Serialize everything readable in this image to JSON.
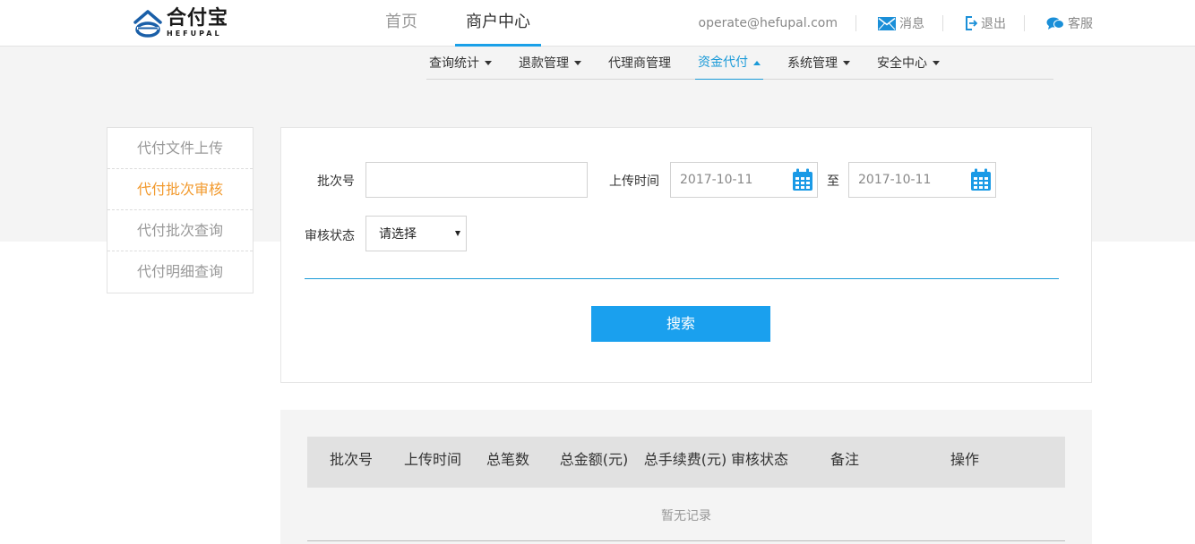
{
  "brand": {
    "name_cn": "合付宝",
    "name_en": "HEFUPAL",
    "color": "#1a5fa8"
  },
  "main_nav": [
    {
      "label": "首页",
      "active": false
    },
    {
      "label": "商户中心",
      "active": true
    }
  ],
  "user_bar": {
    "email": "operate@hefupal.com",
    "messages": "消息",
    "logout": "退出",
    "service": "客服"
  },
  "sub_nav": [
    {
      "label": "查询统计",
      "has_dropdown": true,
      "active": false
    },
    {
      "label": "退款管理",
      "has_dropdown": true,
      "active": false
    },
    {
      "label": "代理商管理",
      "has_dropdown": false,
      "active": false
    },
    {
      "label": "资金代付",
      "has_dropdown": true,
      "active": true
    },
    {
      "label": "系统管理",
      "has_dropdown": true,
      "active": false
    },
    {
      "label": "安全中心",
      "has_dropdown": true,
      "active": false
    }
  ],
  "side_menu": [
    {
      "label": "代付文件上传",
      "active": false
    },
    {
      "label": "代付批次审核",
      "active": true
    },
    {
      "label": "代付批次查询",
      "active": false
    },
    {
      "label": "代付明细查询",
      "active": false
    }
  ],
  "search": {
    "batch_label": "批次号",
    "batch_value": "",
    "upload_time_label": "上传时间",
    "date_from": "2017-10-11",
    "to_label": "至",
    "date_to": "2017-10-11",
    "status_label": "审核状态",
    "status_value": "请选择",
    "button": "搜索"
  },
  "table": {
    "columns": [
      "批次号",
      "上传时间",
      "总笔数",
      "总金额(元)",
      "总手续费(元)",
      "审核状态",
      "备注",
      "操作"
    ],
    "empty_text": "暂无记录"
  },
  "colors": {
    "accent": "#1aa0ee",
    "active_side": "#f29a2e"
  }
}
